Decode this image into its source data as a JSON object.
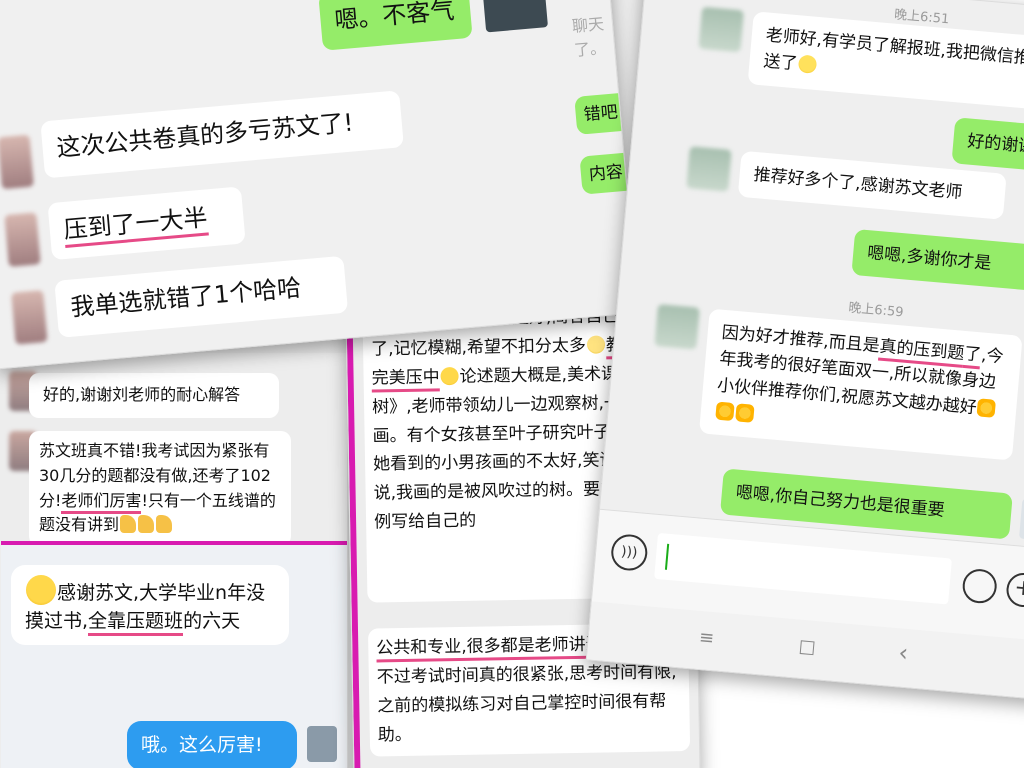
{
  "panel_top_left": {
    "bubble_thanks": "嗯。不客气",
    "bubble_exam": "这次公共卷真的多亏苏文了!",
    "bubble_hit": "压到了一大半",
    "bubble_single": "我单选就错了1个哈哈",
    "peek_chat": "聊天了。",
    "peek_1": "错吧!",
    "peek_2": "内容"
  },
  "panel_left_bottom": {
    "bubble_ok": "好的,谢谢刘老师的耐心解答",
    "bubble_class_a": "苏文班真不错!我考试因为紧张有30几分的题都没有做,还考了102分!",
    "bubble_class_hl": "老师们厉害",
    "bubble_class_b": "!只有一个五线谱的题没有讲到",
    "bubble_grad_a": "感谢苏文,大学毕业n年没摸过书,",
    "bubble_grad_hl": "全靠压题班",
    "bubble_grad_b": "的六天",
    "bubble_wow": "哦。这么厉害!"
  },
  "panel_middle": {
    "bubble_long_1": "谢谢老师关心,还好还好,简答自己偷懒了,记忆模糊,希望不扣分太多",
    "bubble_long_hl": "教案苏文完美压中",
    "bubble_long_2": "论述题大概是,美术课《银树》,老师带领幼儿一边观察树,一边绘画。有个女孩甚至叶子研究叶子的脉络,她看到的小男孩画的不太好,笑话他男孩说,我画的是被风吹过的树。要求根据案例写给自己的",
    "bubble_pro_hl": "公共和专业,很多都是老师讲过的",
    "bubble_pro_2": "内容",
    "bubble_pro_3": "不过考试时间真的很紧张,思考时间有限,之前的模拟练习对自己掌控时间很有帮助。"
  },
  "panel_right": {
    "time_1": "晚上6:51",
    "bubble_teacher": "老师好,有学员了解报班,我把微信推送了",
    "bubble_thanks": "好的谢谢",
    "bubble_recommend": "推荐好多个了,感谢苏文老师",
    "bubble_reply": "嗯嗯,多谢你才是",
    "time_2": "晚上6:59",
    "bubble_because_1": "因为好才推荐,而且是",
    "bubble_because_hl_1": "真的压到题",
    "bubble_because_hl_2": "了",
    "bubble_because_2": ",今年我考的很好笔面双一,所以就像身边小伙伴推荐你们,祝愿苏文越办越好",
    "bubble_effort": "嗯嗯,你自己努力也是很重要",
    "nav_menu": "≡",
    "nav_home": "□",
    "nav_back": "‹"
  },
  "colors": {
    "bubble_green": "#95ec69",
    "highlight_pink": "#e64a87",
    "chat_bg": "#ededed"
  },
  "icons": [
    "voice-icon",
    "emoji-face-icon",
    "plus-icon",
    "menu-icon",
    "home-icon",
    "back-icon"
  ]
}
